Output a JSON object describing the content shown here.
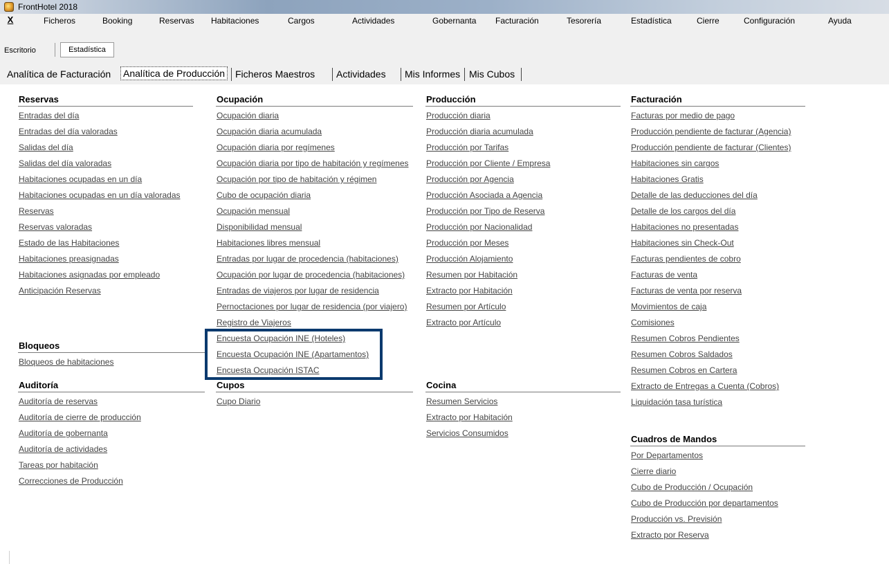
{
  "window": {
    "title": "FrontHotel 2018"
  },
  "menu": {
    "close_label": "X",
    "items": [
      "Ficheros",
      "Booking",
      "Reservas",
      "Habitaciones",
      "Cargos",
      "Actividades",
      "Gobernanta",
      "Facturación",
      "Tesorería",
      "Estadística",
      "Cierre",
      "Configuración",
      "Ayuda"
    ]
  },
  "desktop": {
    "escritorio": "Escritorio",
    "estadistica": "Estadística"
  },
  "tabs": [
    "Analítica de Facturación",
    "Analítica de Producción",
    "Ficheros Maestros",
    "Actividades",
    "Mis Informes",
    "Mis Cubos"
  ],
  "active_tab": "Analítica de Producción",
  "sections": {
    "reservas": {
      "title": "Reservas",
      "links": [
        "Entradas del día",
        "Entradas del día valoradas",
        "Salidas del día",
        "Salidas del día valoradas",
        "Habitaciones ocupadas en un día",
        "Habitaciones ocupadas en un día valoradas",
        "Reservas",
        "Reservas valoradas",
        "Estado de las Habitaciones",
        "Habitaciones preasignadas",
        "Habitaciones asignadas por empleado",
        "Anticipación Reservas"
      ]
    },
    "bloqueos": {
      "title": "Bloqueos",
      "links": [
        "Bloqueos de habitaciones"
      ]
    },
    "auditoria": {
      "title": "Auditoría",
      "links": [
        "Auditoría de reservas",
        "Auditoría de cierre de producción",
        "Auditoría de gobernanta",
        "Auditoría de actividades",
        "Tareas por habitación",
        "Correcciones de Producción"
      ]
    },
    "ocupacion": {
      "title": "Ocupación",
      "links": [
        "Ocupación diaria",
        "Ocupación diaria acumulada",
        "Ocupación diaria por regímenes",
        "Ocupación diaria por tipo de habitación y regímenes",
        "Ocupación por tipo de habitación y régimen",
        "Cubo de ocupación diaria",
        "Ocupación mensual",
        "Disponibilidad mensual",
        "Habitaciones libres mensual",
        "Entradas por lugar de procedencia (habitaciones)",
        "Ocupación por lugar de procedencia (habitaciones)",
        "Entradas de viajeros por lugar de residencia",
        "Pernoctaciones por lugar de residencia (por viajero)",
        "Registro de Viajeros",
        "Encuesta Ocupación INE (Hoteles)",
        "Encuesta Ocupación INE (Apartamentos)",
        "Encuesta Ocupación ISTAC"
      ]
    },
    "cupos": {
      "title": "Cupos",
      "links": [
        "Cupo Diario"
      ]
    },
    "produccion": {
      "title": "Producción",
      "links": [
        "Producción diaria",
        "Producción diaria acumulada",
        "Producción por Tarifas",
        "Producción por Cliente / Empresa",
        "Producción por Agencia",
        "Producción Asociada a Agencia",
        "Producción por Tipo de Reserva",
        "Producción por Nacionalidad",
        "Producción por Meses",
        "Producción Alojamiento",
        "Resumen por Habitación",
        "Extracto por Habitación",
        "Resumen por Artículo",
        "Extracto por Artículo"
      ]
    },
    "cocina": {
      "title": "Cocina",
      "links": [
        "Resumen Servicios",
        "Extracto por Habitación",
        "Servicios Consumidos"
      ]
    },
    "facturacion": {
      "title": "Facturación",
      "links": [
        "Facturas por medio de pago",
        "Producción pendiente de facturar  (Agencia)",
        "Producción pendiente de facturar (Clientes)",
        "Habitaciones sin cargos",
        "Habitaciones Gratis",
        "Detalle de las deducciones del día",
        "Detalle de los cargos del día",
        "Habitaciones no presentadas",
        "Habitaciones sin Check-Out",
        "Facturas pendientes de cobro",
        "Facturas de venta",
        "Facturas de venta por reserva",
        "Movimientos de caja",
        "Comisiones",
        "Resumen Cobros Pendientes",
        "Resumen Cobros Saldados",
        "Resumen Cobros en Cartera",
        "Extracto de Entregas a Cuenta (Cobros)",
        "Liquidación tasa turística"
      ]
    },
    "cuadros": {
      "title": "Cuadros de Mandos",
      "links": [
        "Por Departamentos",
        "Cierre diario",
        "Cubo de Producción / Ocupación",
        "Cubo de Producción por departamentos",
        "Producción vs. Previsión",
        "Extracto por Reserva"
      ]
    }
  },
  "colors": {
    "link": "#444444",
    "highlight_border": "#0b3a6e"
  }
}
